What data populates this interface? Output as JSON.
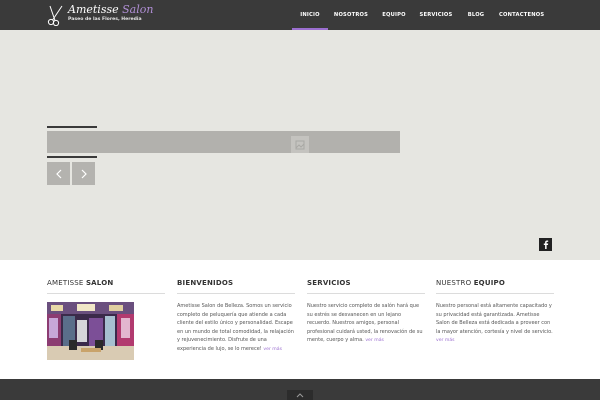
{
  "header": {
    "logo_title_main": "Ametisse ",
    "logo_title_accent": "Salon",
    "logo_subtitle": "Paseo de las Flores, Heredia",
    "logo_icon": "scissors-icon",
    "nav": [
      {
        "label": "INICIO",
        "active": true
      },
      {
        "label": "NOSOTROS",
        "active": false
      },
      {
        "label": "EQUIPO",
        "active": false
      },
      {
        "label": "SERVICIOS",
        "active": false
      },
      {
        "label": "BLOG",
        "active": false
      },
      {
        "label": "CONTACTENOS",
        "active": false
      }
    ]
  },
  "hero": {
    "prev_icon": "chevron-left-icon",
    "next_icon": "chevron-right-icon",
    "social_icon": "facebook-icon"
  },
  "columns": {
    "salon": {
      "title_light": "AMETISSE ",
      "title_bold": "SALON"
    },
    "bienvenidos": {
      "title": "BIENVENIDOS",
      "text": "Ametisse Salon de Belleza. Somos un servicio completo de peluquería que atiende a cada cliente del estilo único y personalidad. Escape en un mundo de total comodidad, la relajación y rejuvenecimiento. Disfrute de una experiencia de lujo, se lo merece!",
      "link": "ver más"
    },
    "servicios": {
      "title": "SERVICIOS",
      "text": "Nuestro servicio completo de salón hará que su estrés se desvanecen en un lejano recuerdo. Nuestros amigos, personal profesional cuidará usted, la renovación de su mente, cuerpo y alma.",
      "link": "ver más"
    },
    "equipo": {
      "title_light": "NUESTRO ",
      "title_bold": "EQUIPO",
      "text": "Nuestro personal está altamente capacitado y su privacidad está garantizada. Ametisse Salon de Belleza está dedicada a proveer con la mayor atención, cortesía y nivel de servicio.",
      "link": "ver más"
    }
  },
  "footer": {
    "to_top_icon": "chevron-up-icon"
  },
  "colors": {
    "header_bg": "#3a3a3a",
    "accent": "#9b6fd0",
    "hero_bg": "#e6e6e1"
  }
}
